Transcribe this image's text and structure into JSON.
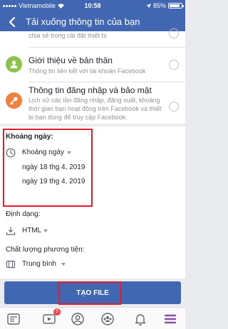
{
  "status_bar": {
    "carrier": "Vietnamobile",
    "time": "10:58",
    "battery": "85%",
    "battery_level": 0.85
  },
  "header": {
    "title": "Tải xuống thông tin của bạn"
  },
  "items": [
    {
      "desc": "chia sẻ trong cài đặt thiết bị"
    },
    {
      "title": "Giới thiệu về bản thân",
      "desc": "Thông tin liên kết với tài khoản Facebook"
    },
    {
      "title": "Thông tin đăng nhập và bảo mật",
      "desc": "Lịch sử các lần đăng nhập, đăng xuất, khoảng thời gian bạn hoạt động trên Facebook và thiết bị bạn dùng để truy cập Facebook."
    }
  ],
  "date_range": {
    "label": "Khoảng ngày:",
    "selector": "Khoảng ngày",
    "start": "ngày 18 thg 4, 2019",
    "end": "ngày 19 thg 4, 2019"
  },
  "format": {
    "label": "Định dạng:",
    "value": "HTML"
  },
  "quality": {
    "label": "Chất lượng phương tiện:",
    "value": "Trung bình"
  },
  "create_button": "TẠO FILE",
  "tab_bar": {
    "video_badge": "5"
  },
  "colors": {
    "brand": "#4267b2",
    "highlight": "#e51d2a",
    "green": "#8bc34a",
    "orange": "#f0803c"
  }
}
